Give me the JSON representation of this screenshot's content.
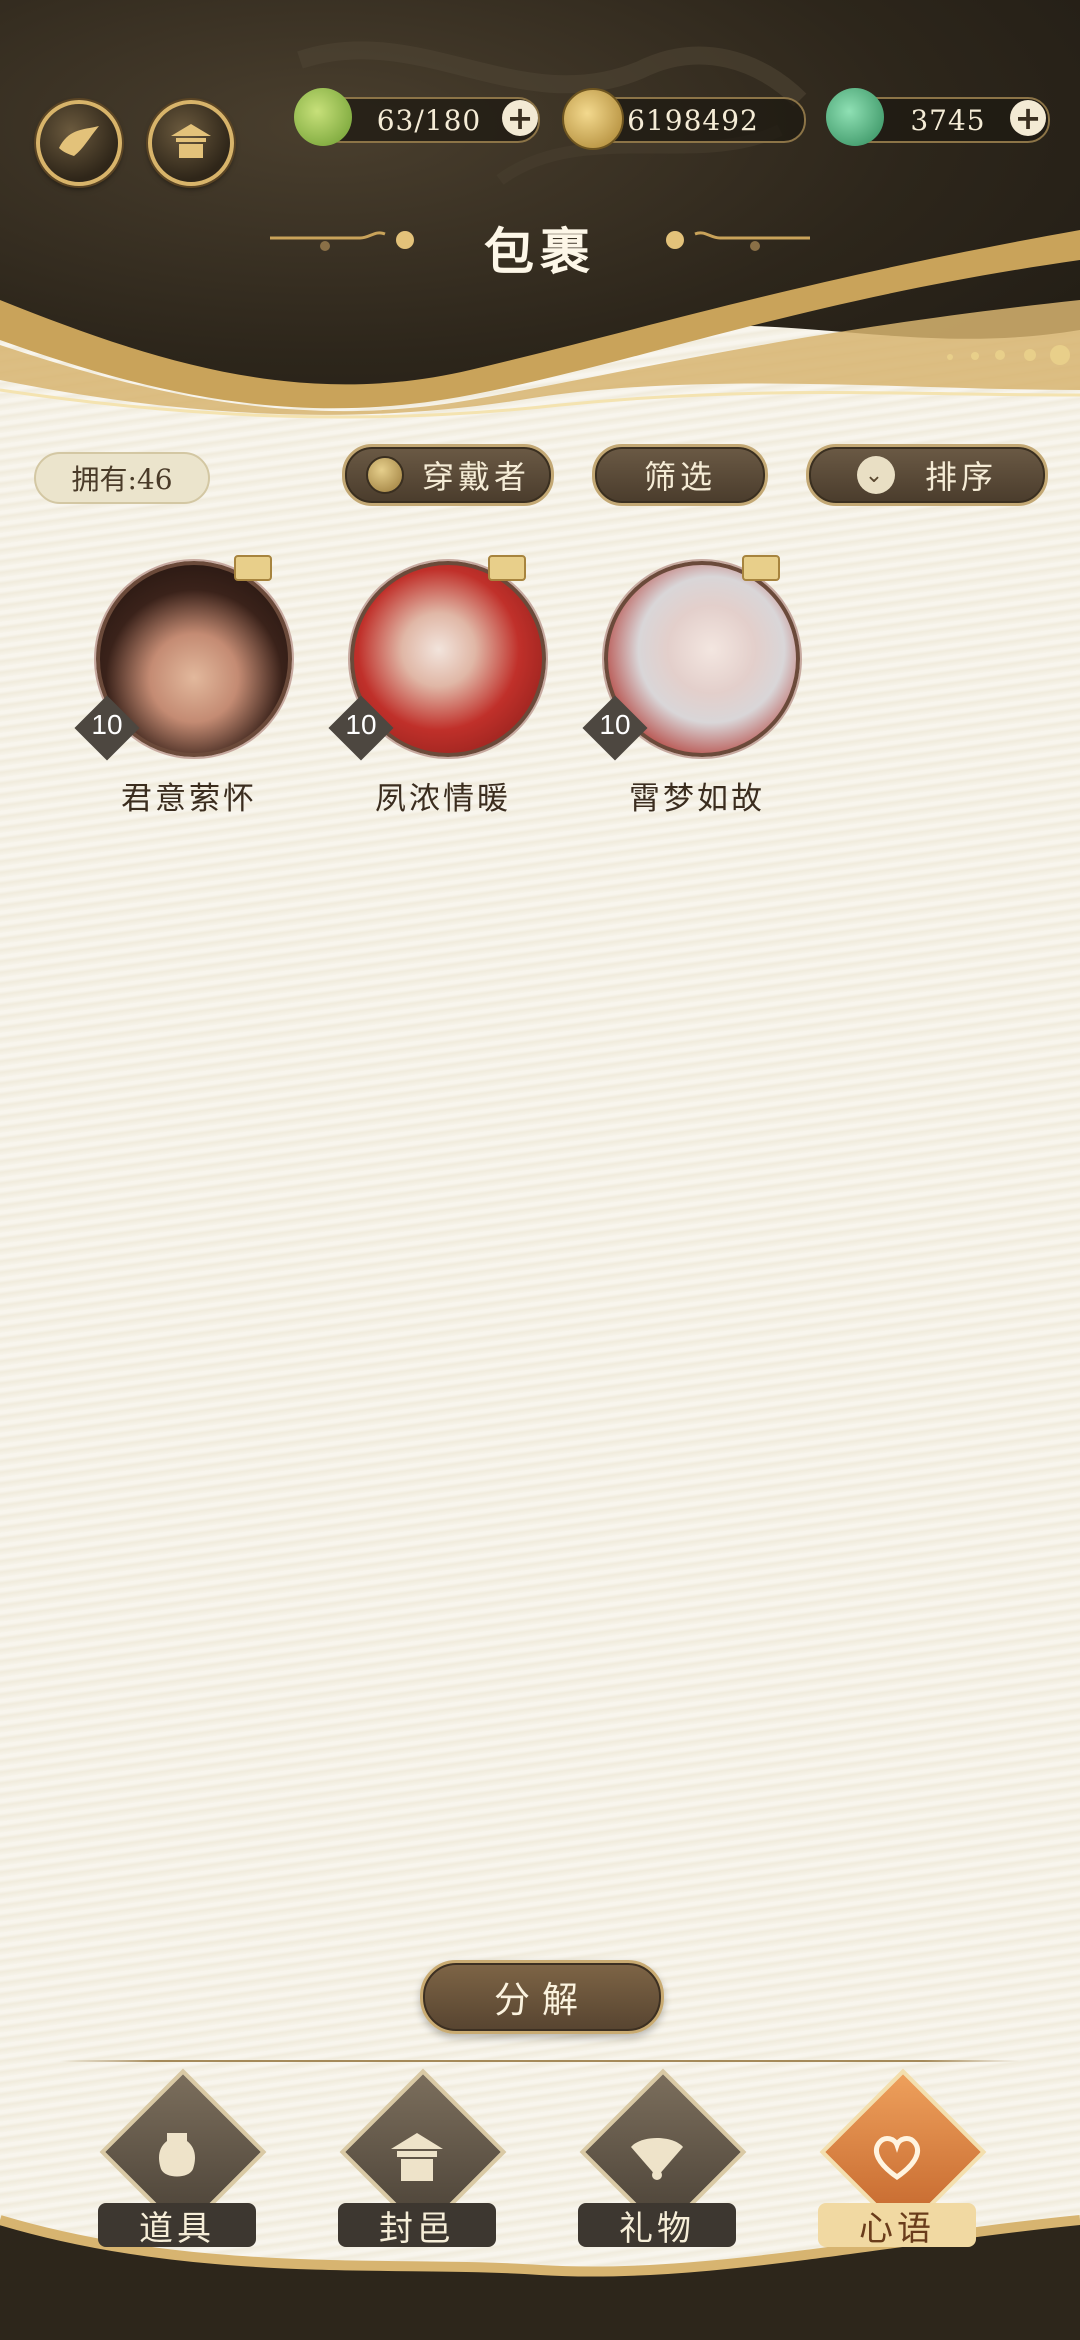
{
  "header": {
    "title": "包裹",
    "resources": [
      {
        "icon": "leaf-icon",
        "value": "63/180",
        "has_plus": true
      },
      {
        "icon": "coin-icon",
        "value": "6198492",
        "has_plus": false
      },
      {
        "icon": "jade-icon",
        "value": "3745",
        "has_plus": true
      }
    ]
  },
  "controls": {
    "owned_count": "拥有:46",
    "wearer_label": "穿戴者",
    "filter_label": "筛选",
    "sort_label": "排序"
  },
  "items": [
    {
      "name": "君意萦怀",
      "level": "10"
    },
    {
      "name": "夙浓情暖",
      "level": "10"
    },
    {
      "name": "霄梦如故",
      "level": "10"
    }
  ],
  "decompose_label": "分解",
  "nav": {
    "tabs": [
      {
        "label": "道具",
        "icon": "vase-icon",
        "active": false
      },
      {
        "label": "封邑",
        "icon": "palace-icon",
        "active": false
      },
      {
        "label": "礼物",
        "icon": "fan-icon",
        "active": false
      },
      {
        "label": "心语",
        "icon": "heart-icon",
        "active": true
      }
    ]
  },
  "colors": {
    "accent_gold": "#d8b46a",
    "header_dark": "#2d261b",
    "active_tab": "#e48a45"
  }
}
